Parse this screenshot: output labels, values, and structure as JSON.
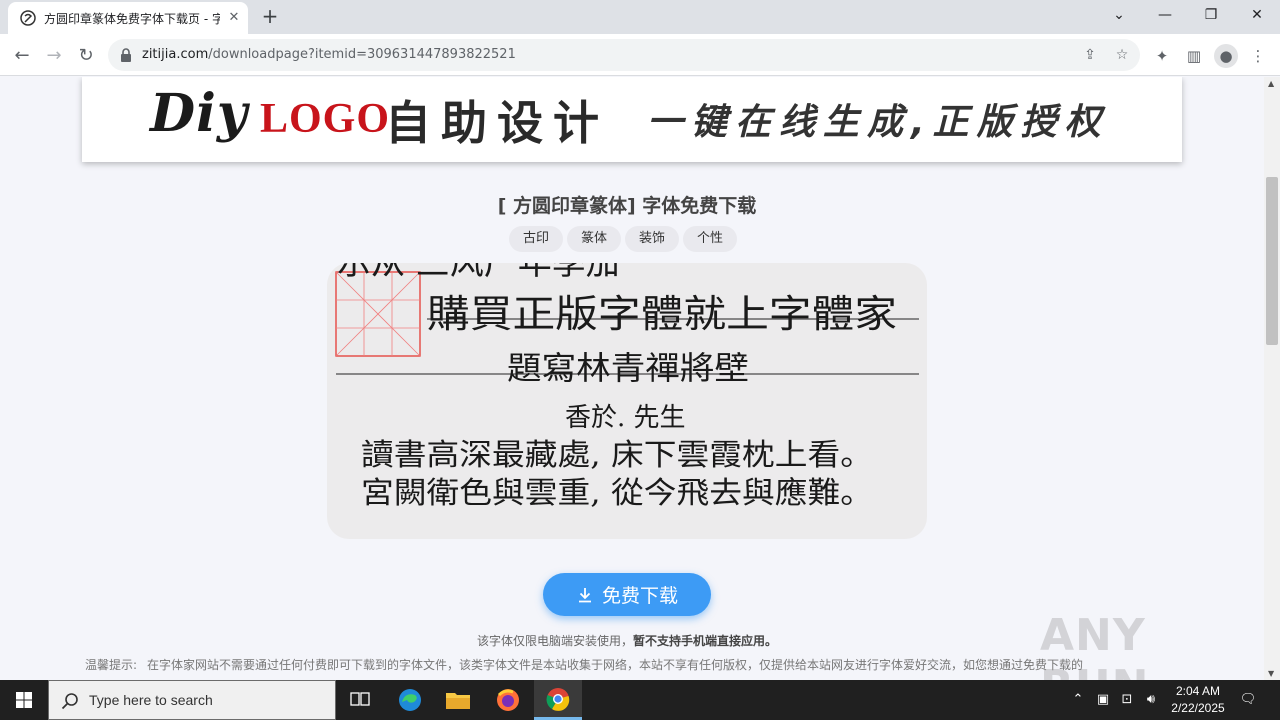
{
  "browser": {
    "tab_title": "方圆印章篆体免费字体下载页 - 字",
    "url_host": "zitijia.com",
    "url_path": "/downloadpage?itemid=309631447893822521"
  },
  "banner": {
    "diy": "Diy",
    "logo": "LOGO",
    "main": "自助设计",
    "sub": "一键在线生成,正版授权"
  },
  "page": {
    "title": "[ 方圆印章篆体] 字体免费下载",
    "tags": [
      "古印",
      "篆体",
      "装饰",
      "个性"
    ],
    "preview": {
      "line0": "示从 三风广年季加",
      "line1": "購買正版字體就上字體家",
      "line2": "題寫林青禪將壁",
      "line3": "香於. 先生",
      "line4": "讀書高深最藏處, 床下雲霞枕上看。",
      "line5": "宮闕衛色與雲重, 從今飛去與應難。"
    },
    "download_label": "免费下载",
    "notice_prefix": "该字体仅限电脑端安装使用，",
    "notice_bold": "暂不支持手机端直接应用。",
    "tip_label": "温馨提示:",
    "tip_text": "在字体家网站不需要通过任何付费即可下载到的字体文件，该类字体文件是本站收集于网络，本站不享有任何版权，仅提供给本站网友进行字体爱好交流，如您想通过免费下载的",
    "watermark": "ANY RUN"
  },
  "taskbar": {
    "search_placeholder": "Type here to search",
    "time": "2:04 AM",
    "date": "2/22/2025"
  },
  "colors": {
    "accent": "#3d9bf5",
    "logo_red": "#c8141b"
  }
}
